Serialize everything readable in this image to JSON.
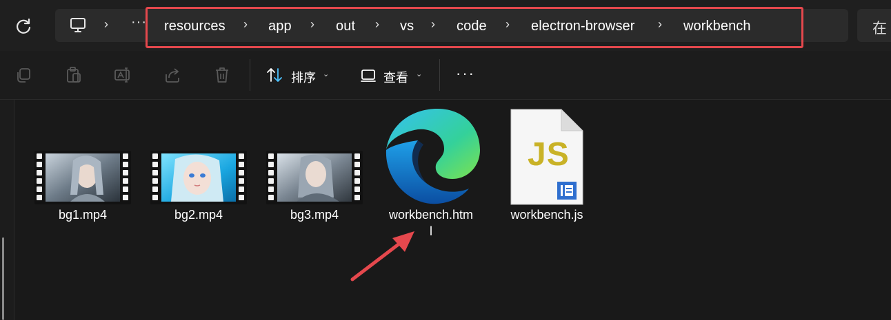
{
  "navigation": {
    "more": "···",
    "breadcrumbs": [
      "resources",
      "app",
      "out",
      "vs",
      "code",
      "electron-browser",
      "workbench"
    ],
    "separator": "›"
  },
  "search": {
    "text": "在"
  },
  "toolbar": {
    "sort_label": "排序",
    "view_label": "查看",
    "more": "···",
    "dropdown_caret": "⌄"
  },
  "files": [
    {
      "name": "bg1.mp4",
      "type": "video"
    },
    {
      "name": "bg2.mp4",
      "type": "video"
    },
    {
      "name": "bg3.mp4",
      "type": "video"
    },
    {
      "name_line1": "workbench.htm",
      "name_line2": "l",
      "type": "html",
      "icon": "edge-icon"
    },
    {
      "name": "workbench.js",
      "type": "javascript",
      "icon_text": "JS"
    }
  ],
  "colors": {
    "highlight": "#e5484d",
    "accent": "#4cc2ff"
  }
}
